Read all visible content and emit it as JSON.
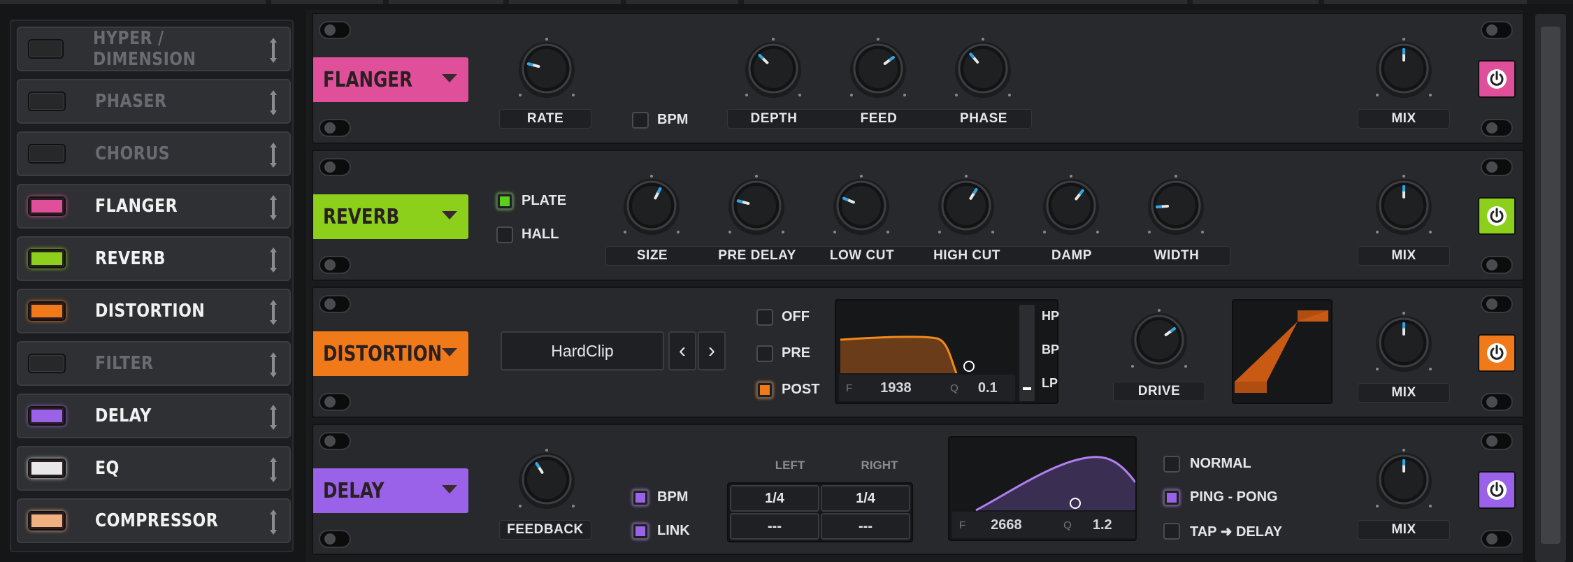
{
  "sidebar": {
    "items": [
      {
        "label": "HYPER / DIMENSION",
        "enabled": false,
        "color": "#3a3c40"
      },
      {
        "label": "PHASER",
        "enabled": false,
        "color": "#3a3c40"
      },
      {
        "label": "CHORUS",
        "enabled": false,
        "color": "#3a3c40"
      },
      {
        "label": "FLANGER",
        "enabled": true,
        "color": "#e0509a"
      },
      {
        "label": "REVERB",
        "enabled": true,
        "color": "#8dd01c"
      },
      {
        "label": "DISTORTION",
        "enabled": true,
        "color": "#f07a1a"
      },
      {
        "label": "FILTER",
        "enabled": false,
        "color": "#3a3c40"
      },
      {
        "label": "DELAY",
        "enabled": true,
        "color": "#9a62e8"
      },
      {
        "label": "EQ",
        "enabled": true,
        "color": "#e8e8e8"
      },
      {
        "label": "COMPRESSOR",
        "enabled": true,
        "color": "#f0b080"
      }
    ]
  },
  "flanger": {
    "name": "FLANGER",
    "color": "#e0509a",
    "knobs": [
      {
        "label": "RATE",
        "value": 0.22
      },
      {
        "label": "DEPTH",
        "value": 0.33
      },
      {
        "label": "FEED",
        "value": 0.7
      },
      {
        "label": "PHASE",
        "value": 0.35
      }
    ],
    "bpm_label": "BPM",
    "bpm_checked": false,
    "mix_label": "MIX",
    "mix": 0.5,
    "power": "on"
  },
  "reverb": {
    "name": "REVERB",
    "color": "#8dd01c",
    "modes": [
      {
        "label": "PLATE",
        "checked": true
      },
      {
        "label": "HALL",
        "checked": false
      }
    ],
    "knobs": [
      {
        "label": "SIZE",
        "value": 0.6
      },
      {
        "label": "PRE DELAY",
        "value": 0.22
      },
      {
        "label": "LOW CUT",
        "value": 0.25
      },
      {
        "label": "HIGH CUT",
        "value": 0.62
      },
      {
        "label": "DAMP",
        "value": 0.64
      },
      {
        "label": "WIDTH",
        "value": 0.15
      }
    ],
    "mix_label": "MIX",
    "mix": 0.5,
    "power": "on"
  },
  "distortion": {
    "name": "DISTORTION",
    "color": "#f07a1a",
    "type": "HardClip",
    "prev": "‹",
    "next": "›",
    "placement": [
      {
        "label": "OFF",
        "checked": false
      },
      {
        "label": "PRE",
        "checked": false
      },
      {
        "label": "POST",
        "checked": true
      }
    ],
    "filter": {
      "f_label": "F",
      "f_value": "1938",
      "q_label": "Q",
      "q_value": "0.1",
      "modes": [
        "HP",
        "BP",
        "LP"
      ],
      "selected": "LP"
    },
    "drive_label": "DRIVE",
    "drive": 0.7,
    "mix_label": "MIX",
    "mix": 0.5,
    "power": "on"
  },
  "delay": {
    "name": "DELAY",
    "color": "#9a62e8",
    "feedback_label": "FEEDBACK",
    "feedback": 0.38,
    "options": [
      {
        "label": "BPM",
        "checked": true
      },
      {
        "label": "LINK",
        "checked": true
      }
    ],
    "left_header": "LEFT",
    "right_header": "RIGHT",
    "left_time": "1/4",
    "right_time": "1/4",
    "left_sub": "---",
    "right_sub": "---",
    "filter": {
      "f_label": "F",
      "f_value": "2668",
      "q_label": "Q",
      "q_value": "1.2"
    },
    "modes": [
      {
        "label": "NORMAL",
        "checked": false
      },
      {
        "label": "PING - PONG",
        "checked": true
      },
      {
        "label": "TAP ➜ DELAY",
        "checked": false
      }
    ],
    "mix_label": "MIX",
    "mix": 0.5,
    "power": "on"
  }
}
